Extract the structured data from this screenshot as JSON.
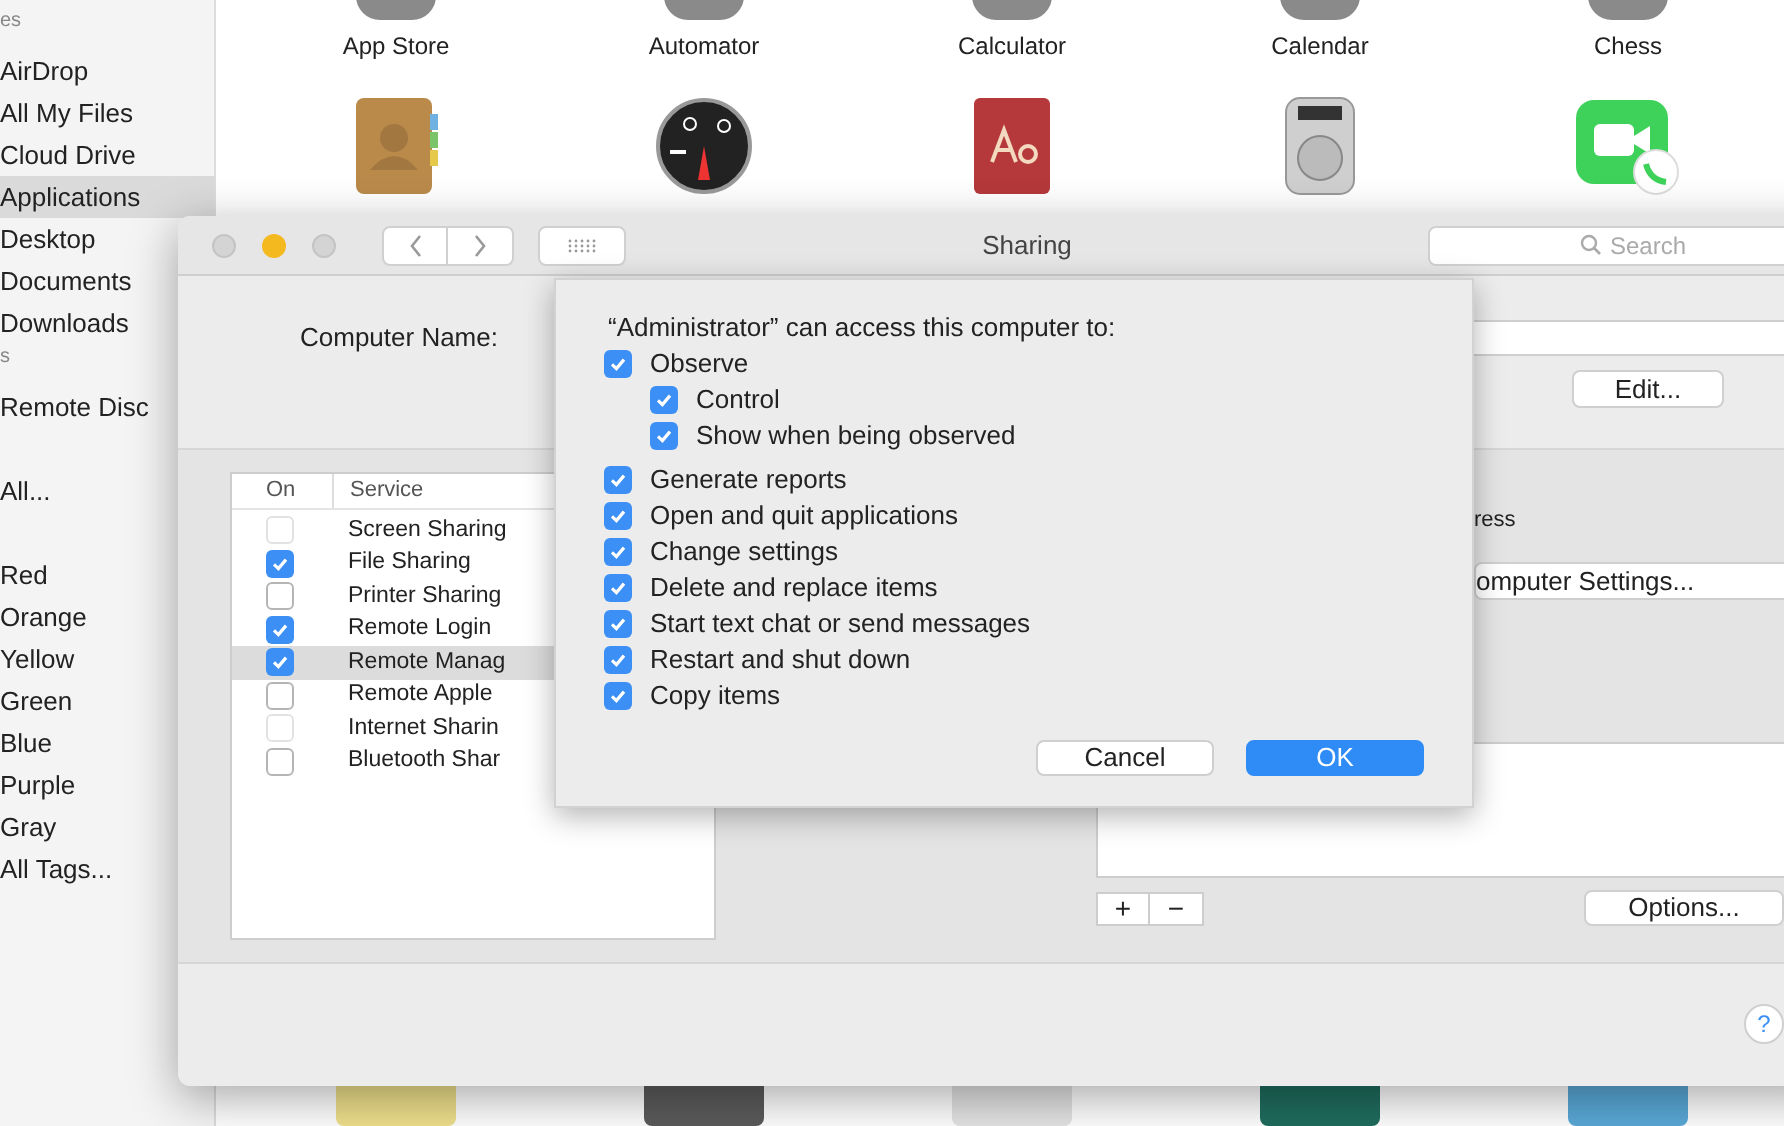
{
  "finder": {
    "sidebar": [
      {
        "kind": "header",
        "label": "es"
      },
      {
        "kind": "item",
        "label": "AirDrop",
        "selected": false
      },
      {
        "kind": "item",
        "label": "All My Files",
        "selected": false
      },
      {
        "kind": "item",
        "label": "Cloud Drive",
        "selected": false
      },
      {
        "kind": "item",
        "label": "Applications",
        "selected": true
      },
      {
        "kind": "item",
        "label": "Desktop",
        "selected": false
      },
      {
        "kind": "item",
        "label": "Documents",
        "selected": false
      },
      {
        "kind": "item",
        "label": "Downloads",
        "selected": false
      },
      {
        "kind": "header",
        "label": "s"
      },
      {
        "kind": "item",
        "label": "Remote Disc",
        "selected": false
      },
      {
        "kind": "gap"
      },
      {
        "kind": "item",
        "label": "All...",
        "selected": false
      },
      {
        "kind": "gap"
      },
      {
        "kind": "item",
        "label": "Red",
        "selected": false
      },
      {
        "kind": "item",
        "label": "Orange",
        "selected": false
      },
      {
        "kind": "item",
        "label": "Yellow",
        "selected": false
      },
      {
        "kind": "item",
        "label": "Green",
        "selected": false
      },
      {
        "kind": "item",
        "label": "Blue",
        "selected": false
      },
      {
        "kind": "item",
        "label": "Purple",
        "selected": false
      },
      {
        "kind": "item",
        "label": "Gray",
        "selected": false
      },
      {
        "kind": "item",
        "label": "All Tags...",
        "selected": false
      }
    ],
    "apps": [
      "App Store",
      "Automator",
      "Calculator",
      "Calendar",
      "Chess"
    ]
  },
  "sharing_window": {
    "title": "Sharing",
    "search": {
      "placeholder": "Search"
    },
    "computer_name_label": "Computer Name:",
    "edit_button": "Edit...",
    "services": {
      "columns": [
        "On",
        "Service"
      ],
      "rows": [
        {
          "name": "Screen Sharing",
          "on": false,
          "disabled": true,
          "selected": false
        },
        {
          "name": "File Sharing",
          "on": true,
          "disabled": false,
          "selected": false
        },
        {
          "name": "Printer Sharing",
          "on": false,
          "disabled": false,
          "selected": false
        },
        {
          "name": "Remote Login",
          "on": true,
          "disabled": false,
          "selected": false
        },
        {
          "name": "Remote Manag",
          "on": true,
          "disabled": false,
          "selected": true
        },
        {
          "name": "Remote Apple",
          "on": false,
          "disabled": false,
          "selected": false
        },
        {
          "name": "Internet Sharin",
          "on": false,
          "disabled": true,
          "selected": false
        },
        {
          "name": "Bluetooth Shar",
          "on": false,
          "disabled": false,
          "selected": false
        }
      ]
    },
    "address_text": "ress",
    "computer_settings_button": "omputer Settings...",
    "add_button": "+",
    "remove_button": "−",
    "options_button": "Options...",
    "help_button": "?"
  },
  "sheet": {
    "heading": "“Administrator” can access this computer to:",
    "permissions": [
      {
        "label": "Observe",
        "checked": true,
        "children": [
          {
            "label": "Control",
            "checked": true
          },
          {
            "label": "Show when being observed",
            "checked": true
          }
        ]
      },
      {
        "label": "Generate reports",
        "checked": true
      },
      {
        "label": "Open and quit applications",
        "checked": true
      },
      {
        "label": "Change settings",
        "checked": true
      },
      {
        "label": "Delete and replace items",
        "checked": true
      },
      {
        "label": "Start text chat or send messages",
        "checked": true
      },
      {
        "label": "Restart and shut down",
        "checked": true
      },
      {
        "label": "Copy items",
        "checked": true
      }
    ],
    "buttons": [
      {
        "label": "Cancel",
        "kind": "secondary"
      },
      {
        "label": "OK",
        "kind": "primary"
      }
    ]
  }
}
